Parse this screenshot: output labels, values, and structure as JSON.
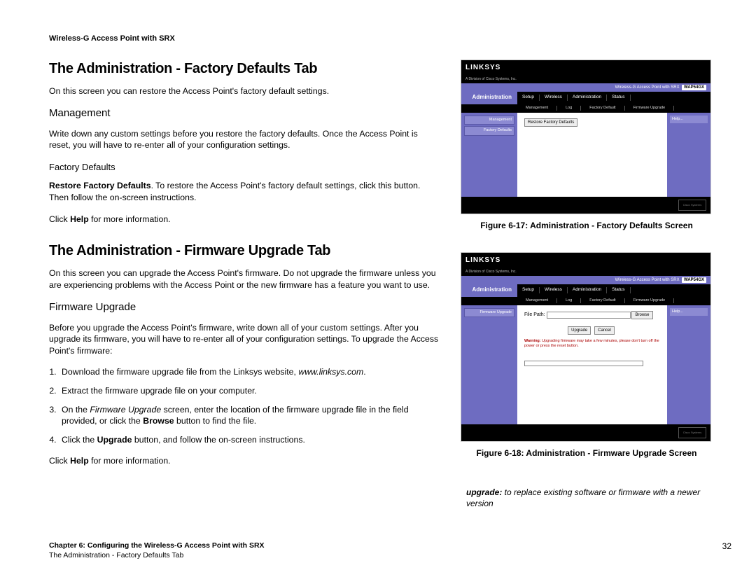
{
  "header": {
    "product": "Wireless-G Access Point with SRX"
  },
  "main": {
    "sec1": {
      "title": "The Administration - Factory Defaults Tab",
      "intro": "On this screen you can restore the Access Point's factory default settings.",
      "management_h": "Management",
      "management_p": "Write down any custom settings before you restore the factory defaults. Once the Access Point is reset, you will have to re-enter all of your configuration settings.",
      "fd_h": "Factory Defaults",
      "fd_bold": "Restore Factory Defaults",
      "fd_rest": ". To restore the Access Point's factory default settings, click this button. Then follow the on-screen instructions.",
      "help_pre": "Click ",
      "help_bold": "Help",
      "help_post": " for more information."
    },
    "sec2": {
      "title": "The Administration - Firmware Upgrade Tab",
      "intro": "On this screen you can upgrade the Access Point's firmware. Do not upgrade the firmware unless you are experiencing problems with the Access Point or the new firmware has a feature you want to use.",
      "fw_h": "Firmware Upgrade",
      "fw_p": "Before you upgrade the Access Point's firmware, write down all of your custom settings. After you upgrade its firmware, you will have to re-enter all of your configuration settings. To upgrade the Access Point's firmware:",
      "step1_pre": "Download the firmware upgrade file from the Linksys website, ",
      "step1_site": "www.linksys.com",
      "step1_post": ".",
      "step2": "Extract the firmware upgrade file on your computer.",
      "step3_pre": "On the ",
      "step3_screen": "Firmware Upgrade",
      "step3_mid": " screen, enter the location of the firmware upgrade file in the field provided, or click the ",
      "step3_btn": "Browse",
      "step3_post": " button to find the file.",
      "step4_pre": "Click the ",
      "step4_btn": "Upgrade",
      "step4_post": " button, and follow the on-screen instructions."
    }
  },
  "side": {
    "fig17_caption": "Figure 6-17: Administration - Factory Defaults Screen",
    "fig18_caption": "Figure 6-18: Administration - Firmware Upgrade Screen",
    "gloss_term": "upgrade:",
    "gloss_def": " to replace existing software or firmware with a newer version"
  },
  "shot": {
    "brand": "LINKSYS",
    "brand_sub": "A Division of Cisco Systems, Inc.",
    "srx_title": "Wireless-G Access Point with SRX",
    "model": "WAP54GX",
    "nav_label": "Administration",
    "tabs": [
      "Setup",
      "Wireless",
      "Administration",
      "Status"
    ],
    "subtabs": [
      "Management",
      "Log",
      "Factory Default",
      "Firmware Upgrade"
    ],
    "left1": "Management",
    "left1b": "Factory Defaults",
    "left2": "Firmware Upgrade",
    "restore_btn": "Restore Factory Defaults",
    "help": "Help...",
    "filepath_label": "File Path:",
    "browse_btn": "Browse",
    "upgrade_btn": "Upgrade",
    "cancel_btn": "Cancel",
    "warning_bold": "Warning:",
    "warning": " Upgrading firmware may take a few minutes, please don't turn off the power or press the reset button.",
    "cisco": "Cisco Systems"
  },
  "footer": {
    "chapter": "Chapter 6: Configuring the Wireless-G Access Point with SRX",
    "subtitle": "The Administration - Factory Defaults Tab",
    "page": "32"
  }
}
